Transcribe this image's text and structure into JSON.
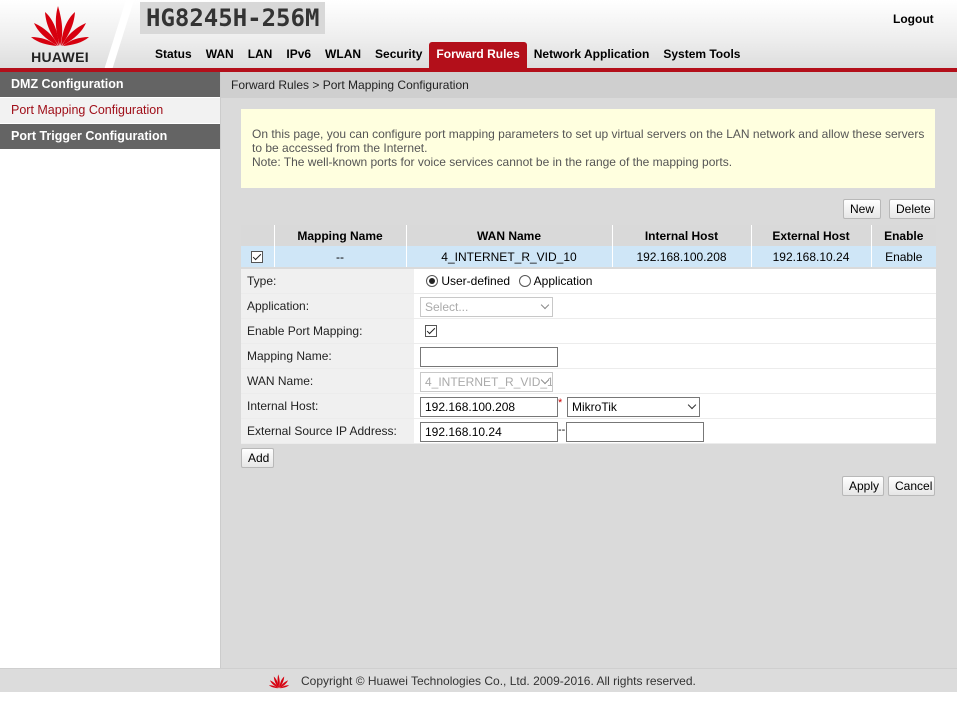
{
  "header": {
    "brand": "HUAWEI",
    "model": "HG8245H-256M",
    "logout": "Logout",
    "nav": [
      {
        "label": "Status"
      },
      {
        "label": "WAN"
      },
      {
        "label": "LAN"
      },
      {
        "label": "IPv6"
      },
      {
        "label": "WLAN"
      },
      {
        "label": "Security"
      },
      {
        "label": "Forward Rules",
        "active": true
      },
      {
        "label": "Network Application"
      },
      {
        "label": "System Tools"
      }
    ]
  },
  "sidebar": {
    "items": [
      {
        "label": "DMZ Configuration"
      },
      {
        "label": "Port Mapping Configuration",
        "selected": true
      },
      {
        "label": "Port Trigger Configuration"
      }
    ]
  },
  "breadcrumb": "Forward Rules > Port Mapping Configuration",
  "notice": {
    "line1": "On this page, you can configure port mapping parameters to set up virtual servers on the LAN network and allow these servers to be accessed from the Internet.",
    "line2": "Note: The well-known ports for voice services cannot be in the range of the mapping ports."
  },
  "buttons": {
    "new": "New",
    "delete": "Delete",
    "add": "Add",
    "apply": "Apply",
    "cancel": "Cancel"
  },
  "table": {
    "columns": [
      "",
      "Mapping Name",
      "WAN Name",
      "Internal Host",
      "External Host",
      "Enable"
    ],
    "rows": [
      {
        "checked": true,
        "mapping_name": "--",
        "wan_name": "4_INTERNET_R_VID_10",
        "internal_host": "192.168.100.208",
        "external_host": "192.168.10.24",
        "enable": "Enable"
      }
    ]
  },
  "form": {
    "type_label": "Type:",
    "type_user_defined": "User-defined",
    "type_application": "Application",
    "application_label": "Application:",
    "application_value": "Select...",
    "enable_label": "Enable Port Mapping:",
    "mapping_name_label": "Mapping Name:",
    "mapping_name_value": "",
    "wan_name_label": "WAN Name:",
    "wan_name_value": "4_INTERNET_R_VID_10",
    "internal_host_label": "Internal Host:",
    "internal_host_value": "192.168.100.208",
    "internal_host_required": "*",
    "internal_host_device": "MikroTik",
    "external_ip_label": "External Source IP Address:",
    "external_ip_start": "192.168.10.24",
    "external_ip_separator": "--",
    "external_ip_end": ""
  },
  "footer": {
    "copyright": "Copyright © Huawei Technologies Co., Ltd. 2009-2016. All rights reserved."
  },
  "colors": {
    "brand_red": "#b30f1a",
    "selected_row": "#cfe6f7",
    "notice_bg": "#ffffdf"
  }
}
